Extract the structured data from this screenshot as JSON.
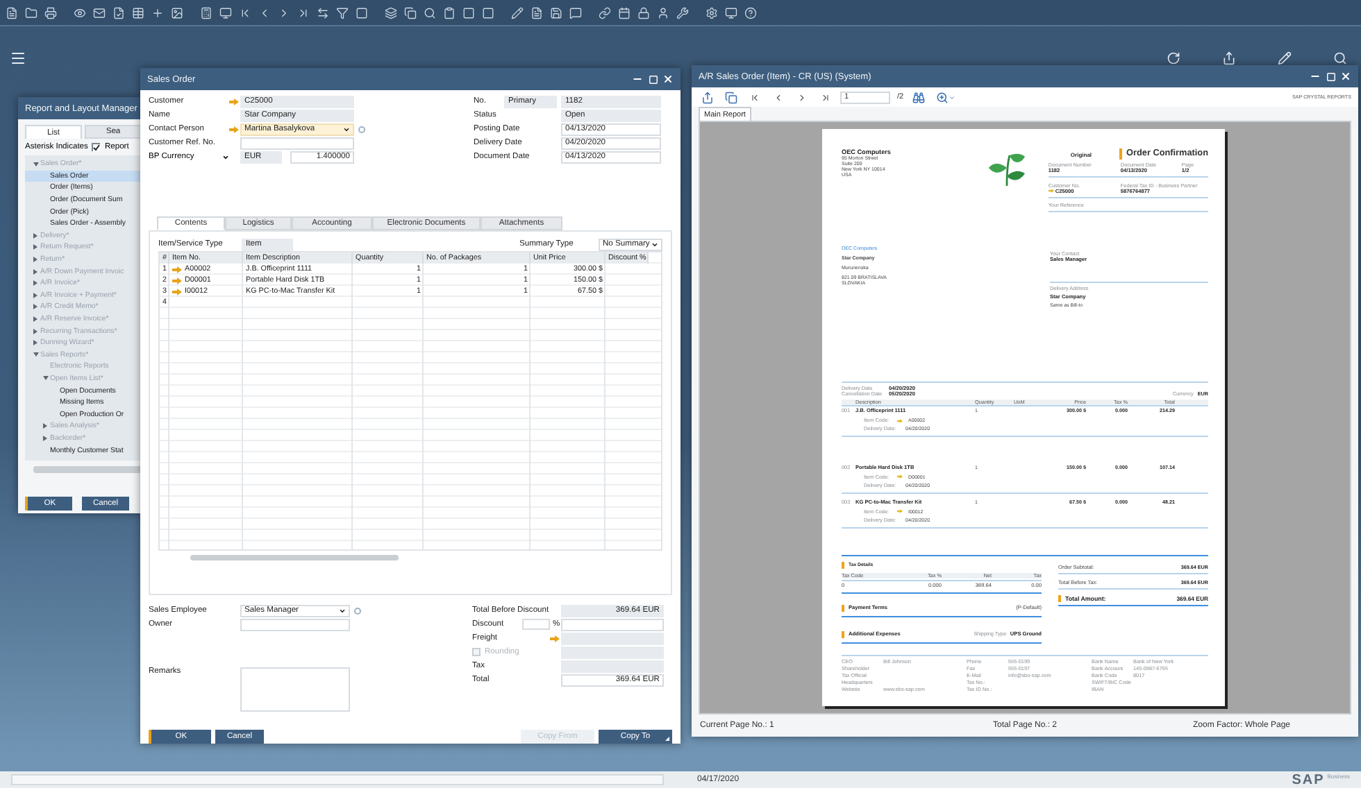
{
  "status_bar": {
    "date": "04/17/2020",
    "brand": "SAP",
    "brand_sub": "Business"
  },
  "report_manager": {
    "title": "Report and Layout Manager",
    "tabs": [
      {
        "label": "List",
        "selected": true
      },
      {
        "label": "Sea",
        "selected": false
      }
    ],
    "filter": {
      "label": "Asterisk Indicates",
      "checked": true,
      "value": "Report"
    },
    "tree": [
      {
        "label": "Sales Order*",
        "kind": "folder",
        "expanded": true,
        "selected": false,
        "children": [
          {
            "label": "Sales Order",
            "kind": "report",
            "selected": true
          },
          {
            "label": "Order (Items)",
            "kind": "report",
            "selected": false
          },
          {
            "label": "Order (Document Sum",
            "kind": "report",
            "selected": false
          },
          {
            "label": "Order (Pick)",
            "kind": "report",
            "selected": false
          },
          {
            "label": "Sales Order - Assembly",
            "kind": "report",
            "selected": false
          }
        ]
      },
      {
        "label": "Delivery*",
        "kind": "folder",
        "expanded": false,
        "selected": false
      },
      {
        "label": "Return Request*",
        "kind": "folder",
        "expanded": false,
        "selected": false
      },
      {
        "label": "Return*",
        "kind": "folder",
        "expanded": false,
        "selected": false
      },
      {
        "label": "A/R Down Payment Invoic",
        "kind": "folder",
        "expanded": false,
        "selected": false
      },
      {
        "label": "A/R Invoice*",
        "kind": "folder",
        "expanded": false,
        "selected": false
      },
      {
        "label": "A/R Invoice + Payment*",
        "kind": "folder",
        "expanded": false,
        "selected": false
      },
      {
        "label": "A/R Credit Memo*",
        "kind": "folder",
        "expanded": false,
        "selected": false
      },
      {
        "label": "A/R Reserve Invoice*",
        "kind": "folder",
        "expanded": false,
        "selected": false
      },
      {
        "label": "Recurring Transactions*",
        "kind": "folder",
        "expanded": false,
        "selected": false
      },
      {
        "label": "Dunning Wizard*",
        "kind": "folder",
        "expanded": false,
        "selected": false
      },
      {
        "label": "Sales Reports*",
        "kind": "folder",
        "expanded": true,
        "selected": false,
        "children": [
          {
            "label": "Electronic Reports",
            "kind": "group",
            "selected": false
          },
          {
            "label": "Open Items List*",
            "kind": "folder",
            "expanded": true,
            "selected": false,
            "children": [
              {
                "label": "Open Documents",
                "kind": "report",
                "selected": false
              },
              {
                "label": "Missing Items",
                "kind": "report",
                "selected": false
              },
              {
                "label": "Open Production Or",
                "kind": "report",
                "selected": false
              }
            ]
          },
          {
            "label": "Sales Analysis*",
            "kind": "folder",
            "expanded": false,
            "selected": false
          },
          {
            "label": "Backorder*",
            "kind": "folder",
            "expanded": false,
            "selected": false
          },
          {
            "label": "Monthly Customer Stat",
            "kind": "report",
            "selected": false
          }
        ]
      }
    ],
    "buttons": [
      "OK",
      "Cancel"
    ]
  },
  "sales_order": {
    "title": "Sales Order",
    "left_fields": [
      {
        "label": "Customer",
        "value": "C25000",
        "kind": "readonly",
        "link": true
      },
      {
        "label": "Name",
        "value": "Star Company",
        "kind": "readonly",
        "link": false
      },
      {
        "label": "Contact Person",
        "value": "Martina  Basalykova",
        "kind": "select",
        "link": true
      },
      {
        "label": "Customer Ref. No.",
        "kind": "input",
        "link": false
      },
      {
        "label": "BP Currency",
        "value": "EUR",
        "rate": "1.400000",
        "kind": "readonly",
        "link": false,
        "label_dropdown": true
      }
    ],
    "right_fields": [
      {
        "label": "No.",
        "series": "Primary",
        "value": "1182",
        "kind": "readonly"
      },
      {
        "label": "Status",
        "value": "Open",
        "kind": "readonly"
      },
      {
        "label": "Posting Date",
        "value": "04/13/2020",
        "kind": "input"
      },
      {
        "label": "Delivery Date",
        "value": "04/20/2020",
        "kind": "input"
      },
      {
        "label": "Document Date",
        "value": "04/13/2020",
        "kind": "input"
      }
    ],
    "tabs": [
      {
        "label": "Contents",
        "selected": true
      },
      {
        "label": "Logistics",
        "selected": false
      },
      {
        "label": "Accounting",
        "selected": false
      },
      {
        "label": "Electronic Documents",
        "selected": false
      },
      {
        "label": "Attachments",
        "selected": false
      }
    ],
    "item_type": {
      "label": "Item/Service Type",
      "value": "Item"
    },
    "summary_type": {
      "label": "Summary Type",
      "value": "No Summary"
    },
    "columns": [
      "#",
      "Item No.",
      "Item Description",
      "Quantity",
      "No. of Packages",
      "Unit Price",
      "Discount %"
    ],
    "rows": [
      {
        "number": "1",
        "item_no": "A00002",
        "description": "J.B. Officeprint 1111",
        "quantity": "1",
        "packages": "1",
        "unit_price": "300.00 $"
      },
      {
        "number": "2",
        "item_no": "D00001",
        "description": "Portable Hard Disk 1TB",
        "quantity": "1",
        "packages": "1",
        "unit_price": "150.00 $"
      },
      {
        "number": "3",
        "item_no": "I00012",
        "description": "KG PC-to-Mac Transfer Kit",
        "quantity": "1",
        "packages": "1",
        "unit_price": "67.50 $"
      },
      {
        "number": "4"
      }
    ],
    "sales_employee": {
      "label": "Sales Employee",
      "value": "Sales Manager"
    },
    "owner": {
      "label": "Owner"
    },
    "remarks": {
      "label": "Remarks"
    },
    "totals": {
      "before_discount": {
        "label": "Total Before Discount",
        "value": "369.64 EUR"
      },
      "discount": {
        "label": "Discount",
        "unit": "%"
      },
      "freight": {
        "label": "Freight"
      },
      "rounding": {
        "label": "Rounding",
        "checked": false,
        "disabled": true
      },
      "tax": {
        "label": "Tax"
      },
      "total": {
        "label": "Total",
        "value": "369.64 EUR"
      }
    },
    "buttons": [
      {
        "label": "OK",
        "kind": "primary",
        "disabled": false
      },
      {
        "label": "Cancel",
        "kind": "primary",
        "disabled": false
      },
      {
        "label": "Copy From",
        "kind": "right",
        "disabled": true
      },
      {
        "label": "Copy To",
        "kind": "right",
        "disabled": false
      }
    ]
  },
  "report_viewer": {
    "title": "A/R Sales Order (Item) - CR (US) (System)",
    "page": "1",
    "page_total": "/2",
    "product": "SAP CRYSTAL REPORTS",
    "tab": {
      "label": "Main Report",
      "selected": true
    },
    "document": {
      "company": "OEC Computers",
      "address": [
        "95 Morton Street",
        "Suite 200",
        "New York NY  10014",
        "USA"
      ],
      "original": "Original",
      "title": "Order Confirmation",
      "info": [
        [
          {
            "label": "Document Number",
            "value": "1182"
          },
          {
            "label": "Document Date",
            "value": "04/13/2020"
          },
          {
            "label": "Page",
            "value": "1/2"
          }
        ],
        [
          {
            "label": "Customer No.",
            "value": "C25000",
            "link": true
          },
          {
            "label": "Federal Tax ID - Business Partner",
            "value": "5876764877"
          }
        ],
        [
          {
            "label": "Your Reference"
          }
        ]
      ],
      "sender_line": "OEC Computers",
      "recipient": [
        "Star Company",
        "Murunenska",
        "821 09 BRATISLAVA\nSLOVAKIA"
      ],
      "contact": {
        "label": "Your Contact",
        "value": "Sales Manager"
      },
      "delivery_address": {
        "label": "Delivery Address",
        "name": "Star Company",
        "note": "Same as Bill-to"
      },
      "dates": [
        {
          "label": "Delivery Date",
          "value": "04/20/2020"
        },
        {
          "label": "Cancellation Date",
          "value": "05/20/2020"
        }
      ],
      "currency": {
        "label": "Currency",
        "value": "EUR"
      },
      "columns": [
        "Description",
        "Quantity",
        "UoM",
        "Price",
        "Tax %",
        "Total"
      ],
      "lines": [
        {
          "number": "001",
          "description": "J.B. Officeprint 1111",
          "quantity": "1",
          "price": "300.00 $",
          "tax": "0.000",
          "total": "214.29",
          "code_label": "Item Code:",
          "code": "A00002",
          "date_label": "Delivery Date:",
          "date": "04/20/2020"
        },
        {
          "number": "002",
          "description": "Portable Hard Disk 1TB",
          "quantity": "1",
          "price": "150.00 $",
          "tax": "0.000",
          "total": "107.14",
          "code_label": "Item Code:",
          "code": "D00001",
          "date_label": "Delivery Date:",
          "date": "04/20/2020"
        },
        {
          "number": "003",
          "description": "KG PC-to-Mac Transfer Kit",
          "quantity": "1",
          "price": "67.50 $",
          "tax": "0.000",
          "total": "48.21",
          "code_label": "Item Code:",
          "code": "I00012",
          "date_label": "Delivery Date:",
          "date": "04/20/2020"
        }
      ],
      "tax_details": {
        "title": "Tax Details",
        "columns": [
          "Tax Code",
          "Tax %",
          "Net",
          "Tax"
        ],
        "row": [
          "0",
          "0.000",
          "369.64",
          "0.00"
        ]
      },
      "totals": [
        {
          "label": "Order Subtotal:",
          "value": "369.64 EUR",
          "kind": "sub"
        },
        {
          "label": "Total Before Tax:",
          "value": "369.64 EUR",
          "kind": "sub"
        },
        {
          "label": "Total Amount:",
          "value": "369.64 EUR",
          "kind": "grand"
        }
      ],
      "payment_terms": {
        "title": "Payment Terms",
        "value": "(P-Default)"
      },
      "expenses": {
        "title": "Additional Expenses",
        "label": "Shipping Type:",
        "value": "UPS Ground"
      },
      "footer": [
        [
          {
            "label": "CEO",
            "value": "Bill Johnson"
          },
          {
            "label": "Shareholder"
          },
          {
            "label": "Tax Official"
          },
          {
            "label": "Headquarters"
          },
          {
            "label": "Website",
            "value": "www.sbo-sap.com"
          }
        ],
        [
          {
            "label": "Phone",
            "value": "555-0199"
          },
          {
            "label": "Fax",
            "value": "555-0197"
          },
          {
            "label": "E-Mail",
            "value": "info@sbo-sap.com"
          },
          {
            "label": "Tax No.:"
          },
          {
            "label": "Tax ID No.:"
          }
        ],
        [
          {
            "label": "Bank Name",
            "value": "Bank of New York"
          },
          {
            "label": "Bank Account",
            "value": "145-0987-6765"
          },
          {
            "label": "Bank Code",
            "value": "8017"
          },
          {
            "label": "SWIFT/BIC Code"
          },
          {
            "label": "IBAN"
          }
        ]
      ]
    },
    "status": [
      "Current Page No.: 1",
      "Total Page No.: 2",
      "Zoom Factor: Whole Page"
    ]
  }
}
